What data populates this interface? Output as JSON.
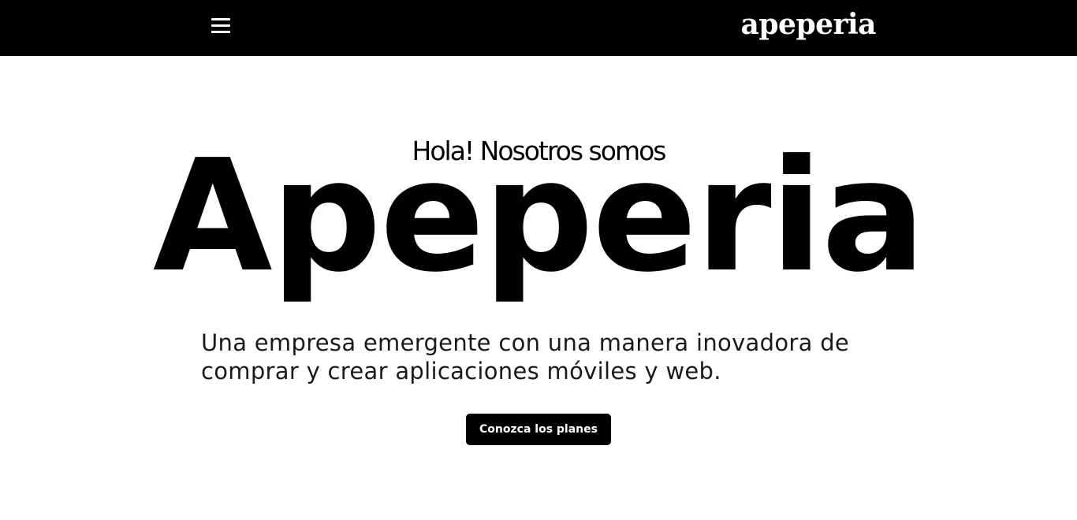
{
  "navbar": {
    "brand": "apeperia",
    "menu_icon": "hamburger-menu-icon",
    "background_color": "#000000",
    "text_color": "#ffffff"
  },
  "hero": {
    "greeting": "Hola! Nosotros somos",
    "title": "Apeperia",
    "tagline": "Una empresa emergente con una manera inovadora de comprar y crear aplicaciones móviles y web.",
    "cta_label": "Conozca los planes"
  }
}
